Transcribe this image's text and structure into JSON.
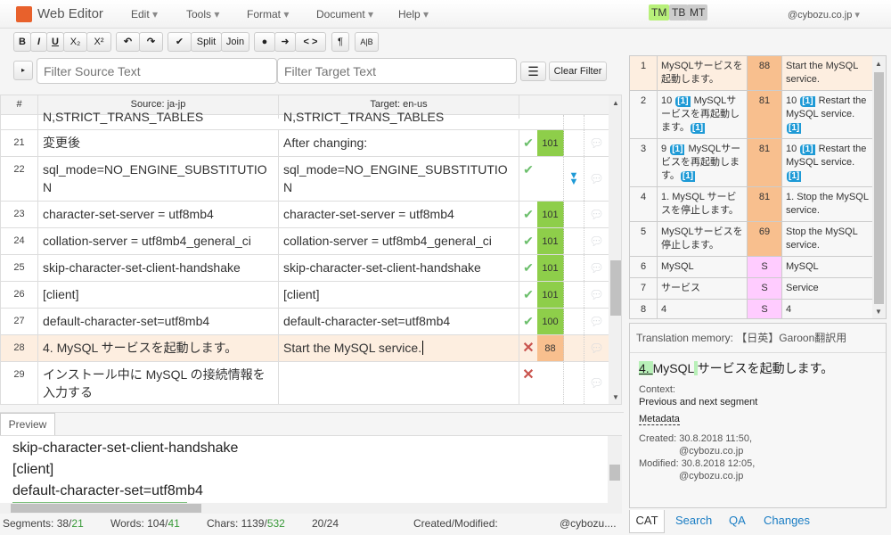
{
  "header": {
    "app_title": "Web Editor",
    "menus": [
      "Edit",
      "Tools",
      "Format",
      "Document",
      "Help"
    ],
    "toggles": [
      {
        "label": "TM",
        "active": true
      },
      {
        "label": "TB",
        "active": false
      },
      {
        "label": "MT",
        "active": false
      }
    ],
    "user": "@cybozu.co.jp"
  },
  "toolbar": {
    "bold": "B",
    "italic": "I",
    "underline": "U",
    "subscript": "X₂",
    "superscript": "X²",
    "confirm": "✔",
    "split": "Split",
    "join": "Join",
    "pilcrow": "¶",
    "case": "A|B",
    "undo": "↶",
    "redo": "↷",
    "circle": "●",
    "arrow": "➜",
    "tags": "< >"
  },
  "filters": {
    "source_placeholder": "Filter Source Text",
    "target_placeholder": "Filter Target Text",
    "clear": "Clear Filter"
  },
  "grid": {
    "headers": [
      "#",
      "Source: ja-jp",
      "Target: en-us"
    ],
    "rows": [
      {
        "num": "",
        "source": "N,STRICT_TRANS_TABLES",
        "target": "N,STRICT_TRANS_TABLES",
        "status": "",
        "match": "",
        "partial": true
      },
      {
        "num": "21",
        "source": "変更後",
        "target": "After changing:",
        "status": "confirmed",
        "match": "101"
      },
      {
        "num": "22",
        "source": "sql_mode=NO_ENGINE_SUBSTITUTION",
        "target": "sql_mode=NO_ENGINE_SUBSTITUTION",
        "status": "confirmed",
        "match": "",
        "icon": "double-arrow-down"
      },
      {
        "num": "23",
        "source": "character-set-server = utf8mb4",
        "target": "character-set-server = utf8mb4",
        "status": "confirmed",
        "match": "101"
      },
      {
        "num": "24",
        "source": "collation-server = utf8mb4_general_ci",
        "target": "collation-server = utf8mb4_general_ci",
        "status": "confirmed",
        "match": "101"
      },
      {
        "num": "25",
        "source": "skip-character-set-client-handshake",
        "target": "skip-character-set-client-handshake",
        "status": "confirmed",
        "match": "101"
      },
      {
        "num": "26",
        "source": "[client]",
        "target": "[client]",
        "status": "confirmed",
        "match": "101"
      },
      {
        "num": "27",
        "source": "default-character-set=utf8mb4",
        "target": "default-character-set=utf8mb4",
        "status": "confirmed",
        "match": "100"
      },
      {
        "num": "28",
        "source": "4. MySQL サービスを起動します。",
        "target": "Start the MySQL service.",
        "status": "unconfirmed",
        "match": "88",
        "selected": true
      },
      {
        "num": "29",
        "source": "インストール中に MySQL の接続情報を入力する",
        "target": "",
        "status": "unconfirmed",
        "match": ""
      }
    ]
  },
  "preview": {
    "tab": "Preview",
    "lines": [
      "skip-character-set-client-handshake",
      "[client]",
      "default-character-set=utf8mb4"
    ]
  },
  "status_bar": {
    "segments_label": "Segments: 38/",
    "segments_done": "21",
    "words_label": "Words: 104/",
    "words_done": "41",
    "chars_label": "Chars: 1139/",
    "chars_done": "532",
    "position": "20/24",
    "created_modified": "Created/Modified:",
    "user": "@cybozu...."
  },
  "matches": [
    {
      "num": "1",
      "source": "MySQLサービスを起動します。",
      "score": "88",
      "target": "Start the MySQL service.",
      "type": "tm",
      "selected": true
    },
    {
      "num": "2",
      "source": "10 [1] MySQLサービスを再起動します。[1]",
      "target": "10 [1] Restart the MySQL service. [1]",
      "score": "81",
      "type": "tm"
    },
    {
      "num": "3",
      "source": "9 [1] MySQLサービスを再起動します。[1]",
      "target": "10 [1] Restart the MySQL service. [1]",
      "score": "81",
      "type": "tm"
    },
    {
      "num": "4",
      "source": "1. MySQL サービスを停止します。",
      "score": "81",
      "target": "1. Stop the MySQL service.",
      "type": "tm"
    },
    {
      "num": "5",
      "source": "MySQLサービスを停止します。",
      "score": "69",
      "target": "Stop the MySQL service.",
      "type": "tm"
    },
    {
      "num": "6",
      "source": "MySQL",
      "score": "S",
      "target": "MySQL",
      "type": "tb"
    },
    {
      "num": "7",
      "source": "サービス",
      "score": "S",
      "target": "Service",
      "type": "tb"
    },
    {
      "num": "8",
      "source": "4",
      "score": "S",
      "target": "4",
      "type": "tb"
    }
  ],
  "tm_detail": {
    "title": "Translation memory: 【日英】Garoon翻訳用",
    "seg_hl1": "4. ",
    "seg_mid": "MySQL",
    "seg_hl2": " ",
    "seg_rest": "サービスを起動します。",
    "context_label": "Context:",
    "context_value": "Previous and next segment",
    "metadata": "Metadata",
    "created": "Created: 30.8.2018 11:50,",
    "created_by": "@cybozu.co.jp",
    "modified": "Modified: 30.8.2018 12:05,",
    "modified_by": "@cybozu.co.jp"
  },
  "bottom_tabs": [
    "CAT",
    "Search",
    "QA",
    "Changes"
  ],
  "colors": {
    "accent": "#1e9ad6",
    "match_101": "#8ece4a",
    "match_fuzzy": "#f8bf8e",
    "term": "#ffccff",
    "selected_row": "#fdeee0",
    "tm_active": "#b8f07a"
  }
}
